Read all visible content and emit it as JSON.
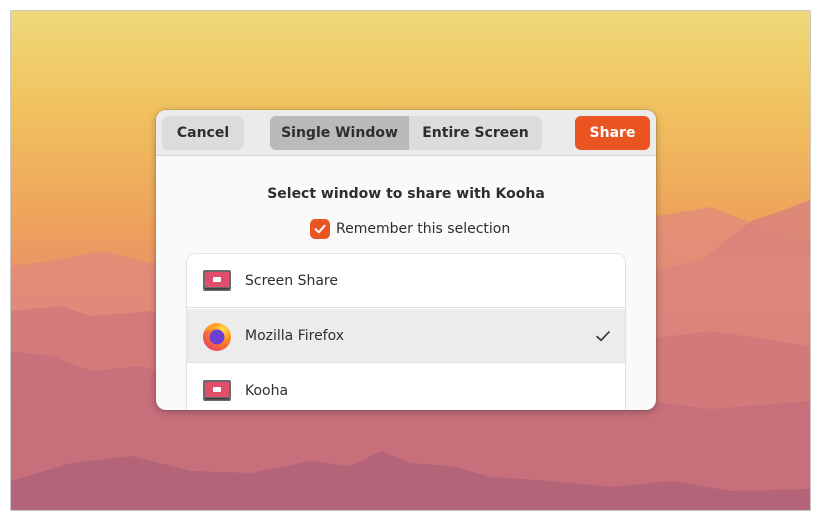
{
  "dialog": {
    "cancel_label": "Cancel",
    "tabs": [
      {
        "label": "Single Window",
        "selected": true
      },
      {
        "label": "Entire Screen",
        "selected": false
      }
    ],
    "share_label": "Share",
    "title": "Select window to share with Kooha",
    "remember": {
      "label": "Remember this selection",
      "checked": true
    },
    "windows": [
      {
        "label": "Screen Share",
        "icon": "screen-share-app-icon",
        "selected": false
      },
      {
        "label": "Mozilla Firefox",
        "icon": "firefox-icon",
        "selected": true
      },
      {
        "label": "Kooha",
        "icon": "kooha-app-icon",
        "selected": false
      }
    ]
  },
  "colors": {
    "accent": "#e95420",
    "selected_tab": "#bababa",
    "selected_row": "#ececec"
  }
}
